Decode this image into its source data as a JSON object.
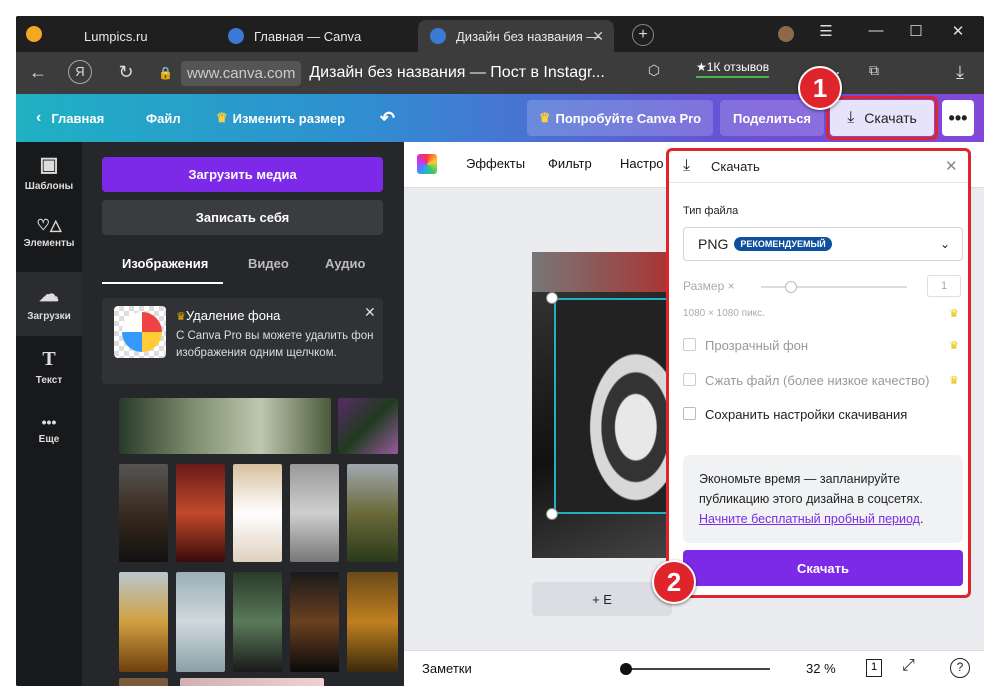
{
  "browser": {
    "tabs": [
      {
        "title": "Lumpics.ru"
      },
      {
        "title": "Главная — Canva"
      },
      {
        "title": "Дизайн без названия —"
      }
    ],
    "url_domain": "www.canva.com",
    "page_title": "Дизайн без названия — Пост в Instagr...",
    "reviews": "★1К отзывов"
  },
  "canva_bar": {
    "home": "Главная",
    "file": "Файл",
    "resize": "Изменить размер",
    "pro": "Попробуйте Canva Pro",
    "share": "Поделиться",
    "download": "Скачать",
    "more": "•••"
  },
  "rail": [
    {
      "label": "Шаблоны",
      "icon": "▣"
    },
    {
      "label": "Элементы",
      "icon": "♡△"
    },
    {
      "label": "Загрузки",
      "icon": "☁"
    },
    {
      "label": "Текст",
      "icon": "T"
    },
    {
      "label": "Еще",
      "icon": "•••"
    }
  ],
  "panel": {
    "upload": "Загрузить медиа",
    "record": "Записать себя",
    "tabs": [
      "Изображения",
      "Видео",
      "Аудио"
    ],
    "promo_title": "Удаление фона",
    "promo_text": "С Canva Pro вы можете удалить фон изображения одним щелчком."
  },
  "toolbar": {
    "effects": "Эффекты",
    "filter": "Фильтр",
    "settings": "Настро"
  },
  "add_page": "+ Е",
  "bottom": {
    "notes": "Заметки",
    "zoom": "32 %",
    "pages": "1",
    "help": "?"
  },
  "download_panel": {
    "title": "Скачать",
    "file_type_label": "Тип файла",
    "file_type": "PNG",
    "badge": "РЕКОМЕНДУЕМЫЙ",
    "size_label": "Размер ×",
    "size_value": "1",
    "dims": "1080 × 1080 пикс.",
    "opt1": "Прозрачный фон",
    "opt2": "Сжать файл (более низкое качество)",
    "opt3": "Сохранить настройки скачивания",
    "info_text": "Экономьте время — запланируйте публикацию этого дизайна в соцсетях.",
    "info_link": "Начните бесплатный пробный период",
    "info_dot": ".",
    "button": "Скачать"
  },
  "callouts": [
    "1",
    "2"
  ],
  "colors": {
    "canva_purple": "#7d2ae8",
    "highlight_red": "#e0242c"
  }
}
